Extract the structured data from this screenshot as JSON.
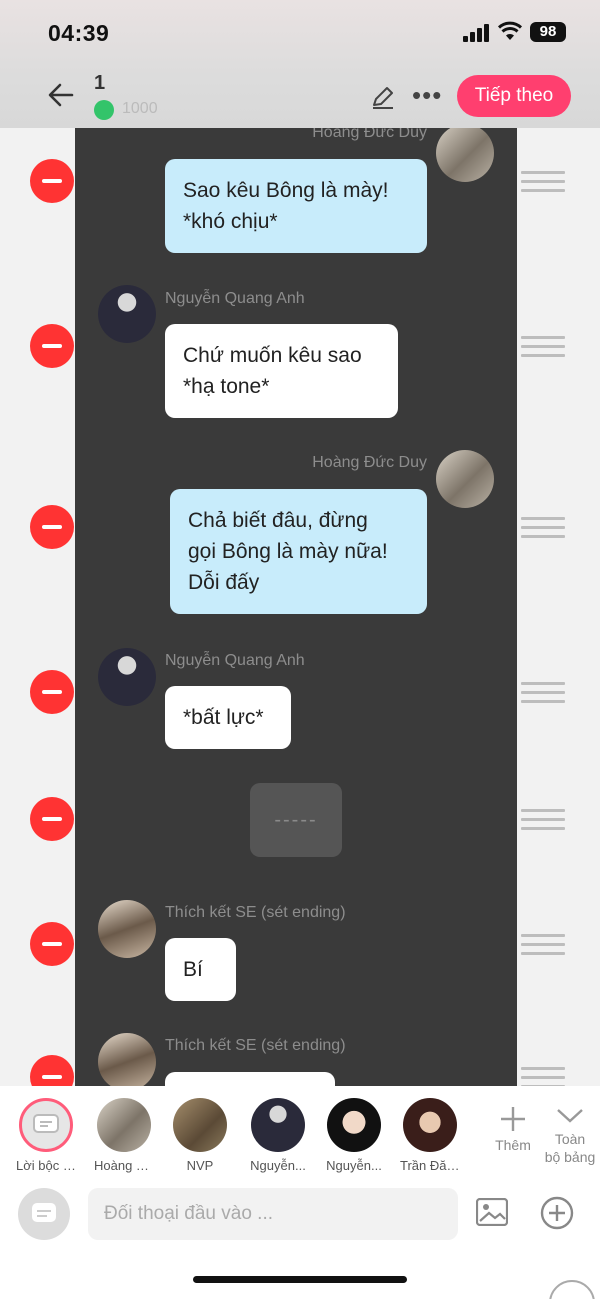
{
  "status_bar": {
    "time": "04:39",
    "battery": "98"
  },
  "header": {
    "title": "1",
    "subtitle": "1000",
    "next_label": "Tiếp theo"
  },
  "messages": [
    {
      "speaker": "Hoàng Đức Duy",
      "side": "right",
      "style": "blue",
      "text": "Sao kêu Bông là mày!\n*khó chịu*"
    },
    {
      "speaker": "Nguyễn Quang Anh",
      "side": "left",
      "style": "white",
      "text": "Chứ muốn kêu sao\n*hạ tone*"
    },
    {
      "speaker": "Hoàng Đức Duy",
      "side": "right",
      "style": "blue",
      "text": "Chả biết đâu, đừng\ngọi Bông là mày nữa!\nDỗi đấy"
    },
    {
      "speaker": "Nguyễn Quang Anh",
      "side": "left",
      "style": "white",
      "text": "*bất lực*"
    },
    {
      "type": "separator",
      "text": "-----"
    },
    {
      "speaker": "Thích kết SE (sét ending)",
      "side": "left",
      "style": "white",
      "text": "Bí"
    },
    {
      "speaker": "Thích kết SE (sét ending)",
      "side": "left",
      "style": "white",
      "text": ""
    }
  ],
  "characters": [
    {
      "label": "Lời bộc b...",
      "selected": true
    },
    {
      "label": "Hoàng Đ..."
    },
    {
      "label": "NVP"
    },
    {
      "label": "Nguyễn..."
    },
    {
      "label": "Nguyễn..."
    },
    {
      "label": "Trần Đăn..."
    }
  ],
  "bottom_actions": {
    "add_label": "Thêm",
    "whole_label_1": "Toàn",
    "whole_label_2": "bộ bảng"
  },
  "input": {
    "placeholder": "Đối thoại đầu vào ..."
  },
  "colors": {
    "accent": "#ff3f6f",
    "remove": "#ff3333",
    "bubble_blue": "#c8ecfb",
    "chat_bg": "#3a3a3a"
  }
}
